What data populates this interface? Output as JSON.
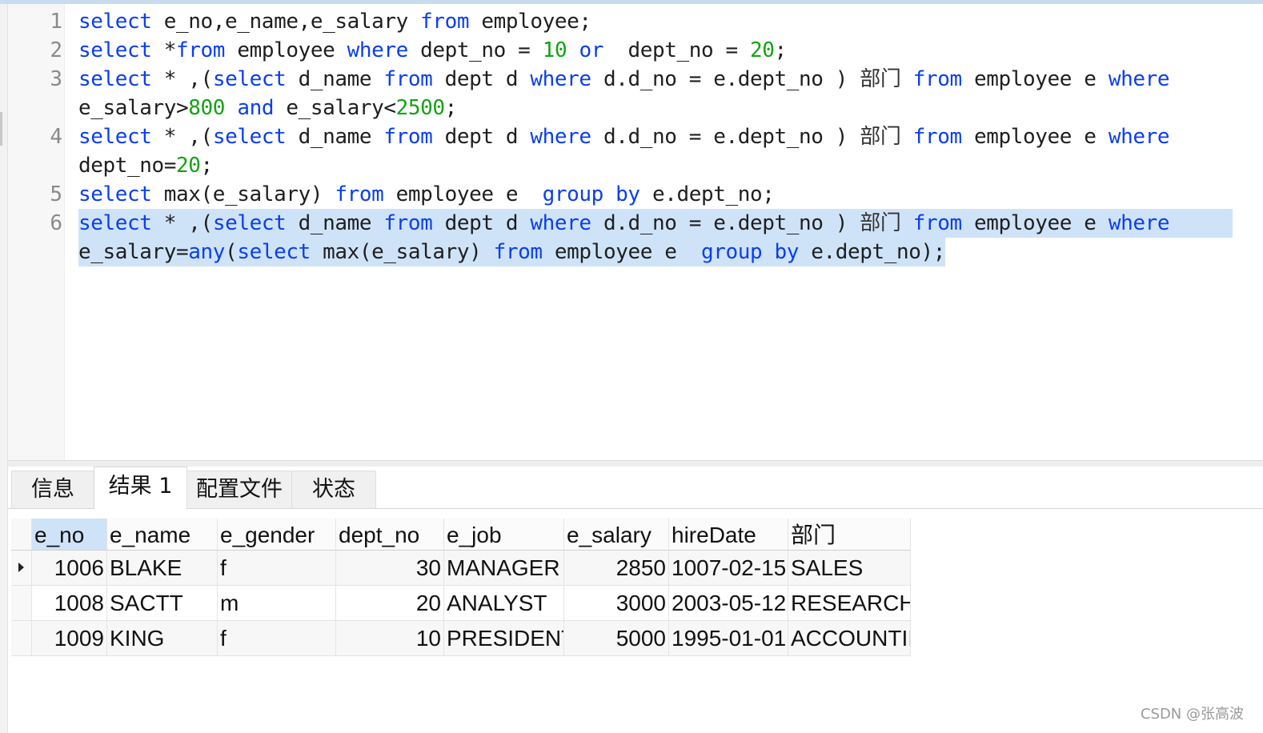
{
  "editor": {
    "line_numbers": [
      "1",
      "2",
      "3",
      "4",
      "5",
      "6"
    ],
    "lines": [
      {
        "num": "1",
        "segments": [
          [
            "kw",
            "select"
          ],
          [
            "t",
            " e_no,e_name,e_salary "
          ],
          [
            "kw",
            "from"
          ],
          [
            "t",
            " employee;"
          ]
        ]
      },
      {
        "num": "2",
        "segments": [
          [
            "kw",
            "select"
          ],
          [
            "t",
            " *"
          ],
          [
            "kw",
            "from"
          ],
          [
            "t",
            " employee "
          ],
          [
            "kw",
            "where"
          ],
          [
            "t",
            " dept_no = "
          ],
          [
            "num",
            "10"
          ],
          [
            "t",
            " "
          ],
          [
            "kw",
            "or"
          ],
          [
            "t",
            "  dept_no = "
          ],
          [
            "num",
            "20"
          ],
          [
            "t",
            ";"
          ]
        ]
      },
      {
        "num": "3",
        "segments": [
          [
            "kw",
            "select"
          ],
          [
            "t",
            " * ,("
          ],
          [
            "kw",
            "select"
          ],
          [
            "t",
            " d_name "
          ],
          [
            "kw",
            "from"
          ],
          [
            "t",
            " dept d "
          ],
          [
            "kw",
            "where"
          ],
          [
            "t",
            " d.d_no = e.dept_no ) "
          ],
          [
            "cjk",
            "部门"
          ],
          [
            "t",
            " "
          ],
          [
            "kw",
            "from"
          ],
          [
            "t",
            " employee e "
          ],
          [
            "kw",
            "where"
          ]
        ]
      },
      {
        "num": "",
        "segments": [
          [
            "t",
            "e_salary>"
          ],
          [
            "num",
            "800"
          ],
          [
            "t",
            " "
          ],
          [
            "kw",
            "and"
          ],
          [
            "t",
            " e_salary<"
          ],
          [
            "num",
            "2500"
          ],
          [
            "t",
            ";"
          ]
        ]
      },
      {
        "num": "4",
        "segments": [
          [
            "kw",
            "select"
          ],
          [
            "t",
            " * ,("
          ],
          [
            "kw",
            "select"
          ],
          [
            "t",
            " d_name "
          ],
          [
            "kw",
            "from"
          ],
          [
            "t",
            " dept d "
          ],
          [
            "kw",
            "where"
          ],
          [
            "t",
            " d.d_no = e.dept_no ) "
          ],
          [
            "cjk",
            "部门"
          ],
          [
            "t",
            " "
          ],
          [
            "kw",
            "from"
          ],
          [
            "t",
            " employee e "
          ],
          [
            "kw",
            "where"
          ]
        ]
      },
      {
        "num": "",
        "segments": [
          [
            "t",
            "dept_no="
          ],
          [
            "num",
            "20"
          ],
          [
            "t",
            ";"
          ]
        ]
      },
      {
        "num": "5",
        "segments": [
          [
            "kw",
            "select"
          ],
          [
            "t",
            " max(e_salary) "
          ],
          [
            "kw",
            "from"
          ],
          [
            "t",
            " employee e  "
          ],
          [
            "kw",
            "group by"
          ],
          [
            "t",
            " e.dept_no;"
          ]
        ]
      },
      {
        "num": "6",
        "segments": [
          [
            "kw",
            "select"
          ],
          [
            "t",
            " * ,("
          ],
          [
            "kw",
            "select"
          ],
          [
            "t",
            " d_name "
          ],
          [
            "kw",
            "from"
          ],
          [
            "t",
            " dept d "
          ],
          [
            "kw",
            "where"
          ],
          [
            "t",
            " d.d_no = e.dept_no ) "
          ],
          [
            "cjk",
            "部门"
          ],
          [
            "t",
            " "
          ],
          [
            "kw",
            "from"
          ],
          [
            "t",
            " employee e "
          ],
          [
            "kw",
            "where"
          ]
        ],
        "selected": true
      },
      {
        "num": "",
        "segments": [
          [
            "t",
            "e_salary="
          ],
          [
            "kw",
            "any"
          ],
          [
            "t",
            "("
          ],
          [
            "kw",
            "select"
          ],
          [
            "t",
            " max(e_salary) "
          ],
          [
            "kw",
            "from"
          ],
          [
            "t",
            " employee e  "
          ],
          [
            "kw",
            "group by"
          ],
          [
            "t",
            " e.dept_no);"
          ]
        ],
        "selected": true
      }
    ]
  },
  "tabs": [
    "信息",
    "结果 1",
    "配置文件",
    "状态"
  ],
  "active_tab": "结果 1",
  "grid": {
    "columns": [
      "e_no",
      "e_name",
      "e_gender",
      "dept_no",
      "e_job",
      "e_salary",
      "hireDate",
      "部门"
    ],
    "rows": [
      [
        "1006",
        "BLAKE",
        "f",
        "30",
        "MANAGER",
        "2850",
        "1007-02-15",
        "SALES"
      ],
      [
        "1008",
        "SACTT",
        "m",
        "20",
        "ANALYST",
        "3000",
        "2003-05-12",
        "RESEARCH"
      ],
      [
        "1009",
        "KING",
        "f",
        "10",
        "PRESIDENT",
        "5000",
        "1995-01-01",
        "ACCOUNTII"
      ]
    ]
  },
  "watermark": "CSDN @张高波",
  "colors": {
    "keyword": "#0a3ef0",
    "number": "#12a312",
    "selection": "#cfe3f8"
  }
}
